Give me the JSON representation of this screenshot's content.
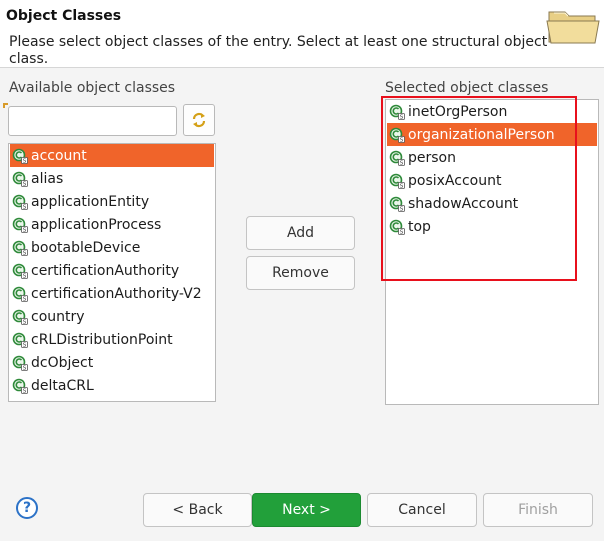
{
  "header": {
    "title": "Object Classes",
    "description": "Please select object classes of the entry. Select at least one structural object class."
  },
  "available": {
    "label": "Available object classes",
    "filter_value": "",
    "items": [
      {
        "label": "account",
        "selected": true
      },
      {
        "label": "alias",
        "selected": false
      },
      {
        "label": "applicationEntity",
        "selected": false
      },
      {
        "label": "applicationProcess",
        "selected": false
      },
      {
        "label": "bootableDevice",
        "selected": false
      },
      {
        "label": "certificationAuthority",
        "selected": false
      },
      {
        "label": "certificationAuthority-V2",
        "selected": false
      },
      {
        "label": "country",
        "selected": false
      },
      {
        "label": "cRLDistributionPoint",
        "selected": false
      },
      {
        "label": "dcObject",
        "selected": false
      },
      {
        "label": "deltaCRL",
        "selected": false
      }
    ]
  },
  "actions": {
    "add": "Add",
    "remove": "Remove"
  },
  "selected": {
    "label": "Selected object classes",
    "items": [
      {
        "label": "inetOrgPerson",
        "selected": false
      },
      {
        "label": "organizationalPerson",
        "selected": true
      },
      {
        "label": "person",
        "selected": false
      },
      {
        "label": "posixAccount",
        "selected": false
      },
      {
        "label": "shadowAccount",
        "selected": false
      },
      {
        "label": "top",
        "selected": false
      }
    ]
  },
  "footer": {
    "help": "?",
    "back": "< Back",
    "next": "Next >",
    "cancel": "Cancel",
    "finish": "Finish"
  },
  "colors": {
    "selection": "#f0642a",
    "primary_button": "#22a03a",
    "highlight_box": "#e8101c"
  }
}
